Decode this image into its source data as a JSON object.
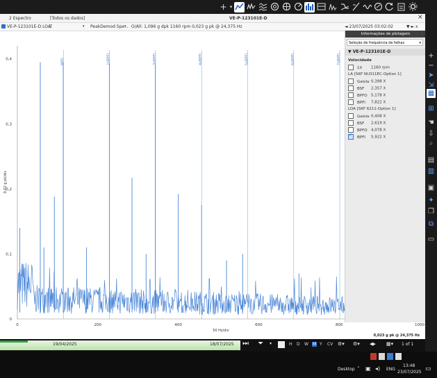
{
  "toolbar": {
    "plus_label": "+",
    "icons": [
      "plus-icon",
      "trend-icon",
      "spectrum-icon",
      "waterfall-icon",
      "orbit-icon",
      "polar-icon",
      "gauge-icon",
      "bar-spectrum-icon",
      "cascade-icon",
      "histogram-icon",
      "bode-icon",
      "phase-icon",
      "wave-icon",
      "circle-icon",
      "refresh-icon",
      "clipboard-icon",
      "settings-icon"
    ]
  },
  "window": {
    "close_label": "×",
    "tab_spectrum": "2 Espectro",
    "tab_all_data": "[Todos os dados]",
    "title": "VE-P-123101E-D"
  },
  "selectors": {
    "point": "VE-P-123101E-D LOA",
    "direction": "Z",
    "measurement": "PeakDemod Spe...",
    "overall": "O/All: 1,096 g dpk  1160 rpm  0,023 g pk @ 24,375 Hz",
    "datetime": "◄ 23/07/2025 03:02:02",
    "nav": "▼ ► x"
  },
  "chart_data": {
    "type": "line",
    "ylabel": "0.02 g pk/div",
    "xlabel": "50 Hz/div",
    "xlim": [
      0,
      1000
    ],
    "ylim": [
      0,
      0.42
    ],
    "x_ticks": [
      "0",
      "200",
      "400",
      "600",
      "800",
      "1000"
    ],
    "x_tick_values": [
      0,
      200,
      400,
      600,
      800,
      1000
    ],
    "y_ticks": [
      "0",
      "0,1",
      "0,2",
      "0,3",
      "0,4"
    ],
    "y_tick_values": [
      0,
      0.1,
      0.2,
      0.3,
      0.4
    ],
    "cursor_readout": "0,023 g pk @ 24,375 Hz",
    "fault_lines": [
      {
        "label": "BPFI",
        "x": 114.5
      },
      {
        "label": "2xBPFI",
        "x": 229
      },
      {
        "label": "3xBPFI",
        "x": 343.5
      },
      {
        "label": "4xBPFI",
        "x": 458
      },
      {
        "label": "5xBPFI",
        "x": 572.5
      },
      {
        "label": "6xBPFI",
        "x": 687
      },
      {
        "label": "7xBPFI",
        "x": 801.5
      }
    ],
    "peaks": [
      {
        "x": 57,
        "y": 0.395
      },
      {
        "x": 114,
        "y": 0.395
      },
      {
        "x": 229,
        "y": 0.393
      },
      {
        "x": 343,
        "y": 0.392
      },
      {
        "x": 92,
        "y": 0.188
      },
      {
        "x": 285,
        "y": 0.217
      },
      {
        "x": 400,
        "y": 0.192
      },
      {
        "x": 458,
        "y": 0.175
      },
      {
        "x": 920,
        "y": 0.288
      },
      {
        "x": 320,
        "y": 0.1
      },
      {
        "x": 6,
        "y": 0.14
      },
      {
        "x": 560,
        "y": 0.1
      },
      {
        "x": 172,
        "y": 0.11
      },
      {
        "x": 66,
        "y": 0.11
      },
      {
        "x": 520,
        "y": 0.09
      },
      {
        "x": 700,
        "y": 0.07
      }
    ],
    "series": [
      {
        "values": [],
        "color": "#4a86d8"
      }
    ]
  },
  "info_panel": {
    "header": "Informações de plotagem",
    "dropdown": "Seleção de frequência de falhas",
    "asset": "VE-P-123101E-D",
    "speed_title": "Velocidade",
    "speed_row": {
      "label": "1X",
      "value": "1160  rpm"
    },
    "la_title": "LA [SKF NU311EC-Option 1]",
    "la_rows": [
      {
        "label": "Gaiola",
        "value": "0,398  X",
        "checked": false
      },
      {
        "label": "BSF",
        "value": "2,357  X",
        "checked": false
      },
      {
        "label": "BPFO",
        "value": "5,178  X",
        "checked": false
      },
      {
        "label": "BPFI",
        "value": "7,822  X",
        "checked": false
      }
    ],
    "loa_title": "LOA [SKF 6211-Option 1]",
    "loa_rows": [
      {
        "label": "Gaiola",
        "value": "0,408  X",
        "checked": false
      },
      {
        "label": "BSF",
        "value": "2,619  X",
        "checked": false
      },
      {
        "label": "BPFO",
        "value": "4,078  X",
        "checked": false
      },
      {
        "label": "BPFI",
        "value": "5,922  X",
        "checked": true
      }
    ]
  },
  "timeline": {
    "start_date": "19/04/2025",
    "end_date": "18/07/2025",
    "periods": [
      "H",
      "D",
      "W",
      "M",
      "Y",
      "CV"
    ],
    "page": "1 of 1"
  },
  "taskbar": {
    "desktop": "Desktop",
    "lang": "ENG",
    "time": "13:48",
    "date": "23/07/2025"
  },
  "colors": {
    "series": "#4a86d8",
    "fault_line": "#7fb2ec",
    "accent": "#1f5fbf"
  }
}
